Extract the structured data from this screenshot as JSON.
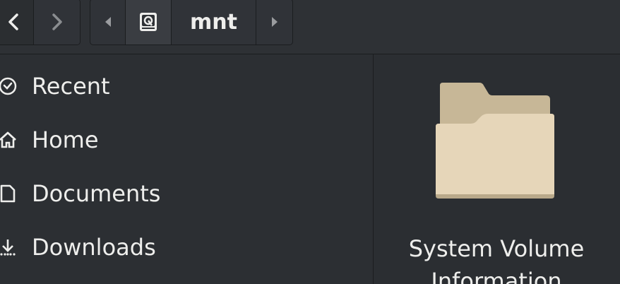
{
  "header": {
    "path_segment": "mnt"
  },
  "sidebar": {
    "items": [
      {
        "label": "Recent",
        "icon": "clock-icon"
      },
      {
        "label": "Home",
        "icon": "home-icon"
      },
      {
        "label": "Documents",
        "icon": "document-icon"
      },
      {
        "label": "Downloads",
        "icon": "download-icon"
      }
    ]
  },
  "main": {
    "items": [
      {
        "name": "System Volume Information",
        "icon": "folder-icon"
      }
    ]
  },
  "colors": {
    "background": "#2b2e32",
    "text": "#eeeeec",
    "folder_back": "#c7b797",
    "folder_front": "#e6d6b9"
  }
}
